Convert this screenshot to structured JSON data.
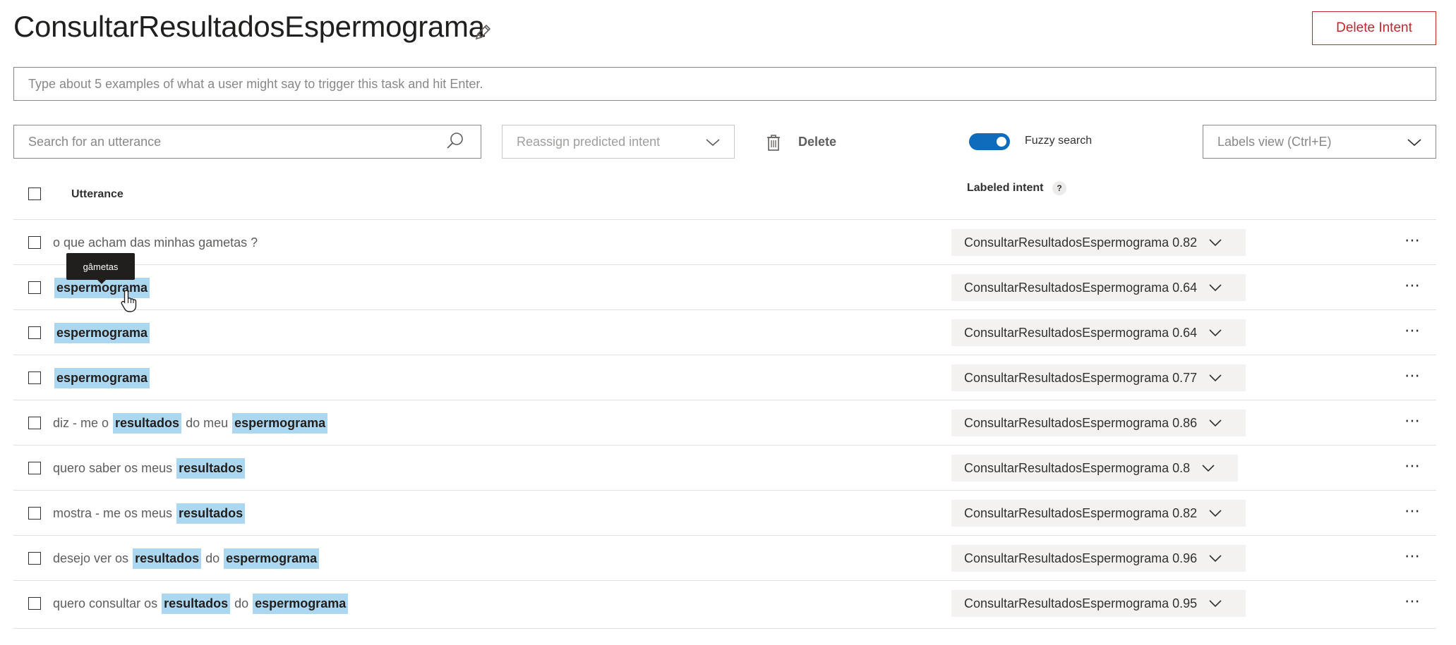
{
  "header": {
    "title": "ConsultarResultadosEspermograma",
    "delete_intent_label": "Delete Intent"
  },
  "example_input": {
    "placeholder": "Type about 5 examples of what a user might say to trigger this task and hit Enter."
  },
  "toolbar": {
    "search_placeholder": "Search for an utterance",
    "reassign_placeholder": "Reassign predicted intent",
    "delete_label": "Delete",
    "fuzzy_search_label": "Fuzzy search",
    "fuzzy_search_on": true,
    "labels_view_label": "Labels view (Ctrl+E)"
  },
  "table": {
    "col_utterance": "Utterance",
    "col_labeled_intent": "Labeled intent",
    "help_glyph": "?",
    "rows": [
      {
        "tokens": [
          {
            "t": "o que acham das minhas gametas ?",
            "e": false
          }
        ],
        "intent": "ConsultarResultadosEspermograma 0.82"
      },
      {
        "tokens": [
          {
            "t": "espermograma",
            "e": true
          }
        ],
        "intent": "ConsultarResultadosEspermograma 0.64"
      },
      {
        "tokens": [
          {
            "t": "espermograma",
            "e": true
          }
        ],
        "intent": "ConsultarResultadosEspermograma 0.64"
      },
      {
        "tokens": [
          {
            "t": "espermograma",
            "e": true
          }
        ],
        "intent": "ConsultarResultadosEspermograma 0.77"
      },
      {
        "tokens": [
          {
            "t": "diz - me o",
            "e": false
          },
          {
            "t": "resultados",
            "e": true
          },
          {
            "t": "do meu",
            "e": false
          },
          {
            "t": "espermograma",
            "e": true
          }
        ],
        "intent": "ConsultarResultadosEspermograma 0.86"
      },
      {
        "tokens": [
          {
            "t": "quero saber os meus",
            "e": false
          },
          {
            "t": "resultados",
            "e": true
          }
        ],
        "intent": "ConsultarResultadosEspermograma 0.8"
      },
      {
        "tokens": [
          {
            "t": "mostra - me os meus",
            "e": false
          },
          {
            "t": "resultados",
            "e": true
          }
        ],
        "intent": "ConsultarResultadosEspermograma 0.82"
      },
      {
        "tokens": [
          {
            "t": "desejo ver os",
            "e": false
          },
          {
            "t": "resultados",
            "e": true
          },
          {
            "t": "do",
            "e": false
          },
          {
            "t": "espermograma",
            "e": true
          }
        ],
        "intent": "ConsultarResultadosEspermograma 0.96"
      },
      {
        "tokens": [
          {
            "t": "quero consultar os",
            "e": false
          },
          {
            "t": "resultados",
            "e": true
          },
          {
            "t": "do",
            "e": false
          },
          {
            "t": "espermograma",
            "e": true
          }
        ],
        "intent": "ConsultarResultadosEspermograma 0.95"
      }
    ],
    "more_glyph": "⋯"
  },
  "tooltip": {
    "text": "gâmetas"
  },
  "colors": {
    "accent": "#0f6cbd",
    "danger": "#c4262e",
    "entity_highlight": "#acd7f1",
    "intent_pill_bg": "#f3f2f1"
  },
  "icons": {
    "edit": "pencil-icon",
    "search": "search-icon",
    "chevron": "chevron-down-icon",
    "delete": "trash-icon",
    "cursor": "hand-pointer-icon"
  }
}
